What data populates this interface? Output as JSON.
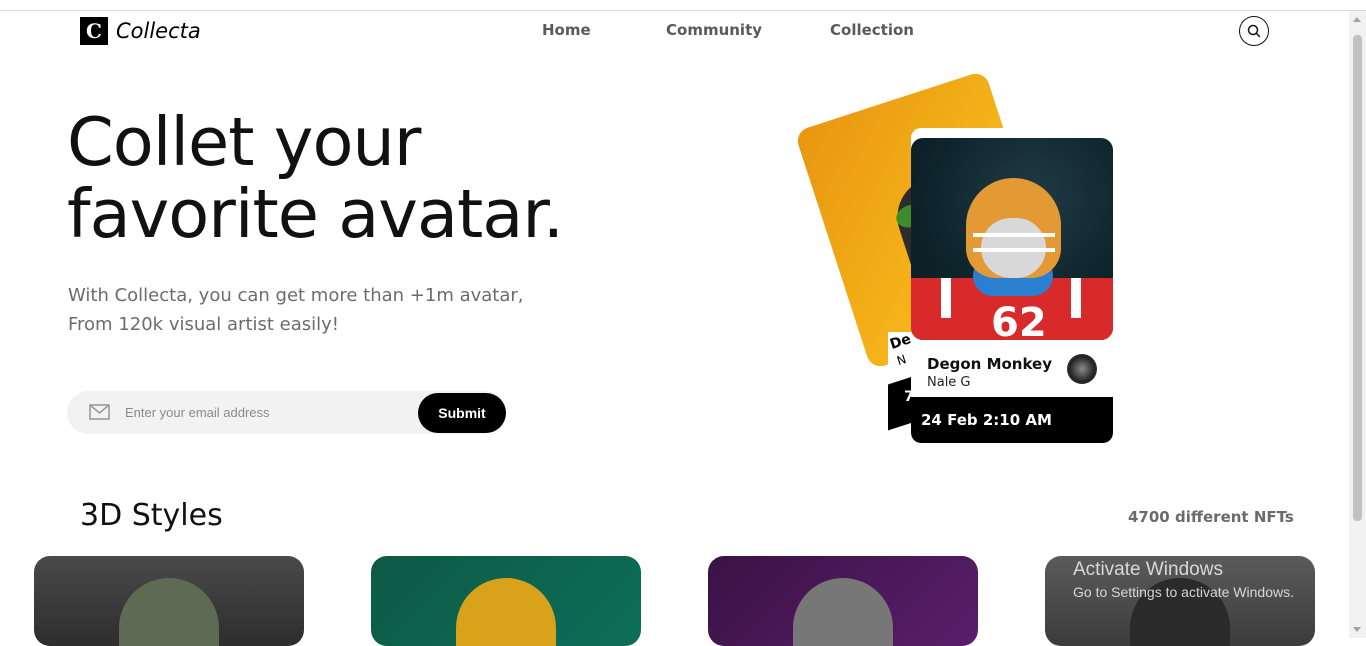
{
  "brand": {
    "mark": "C",
    "name": "Collecta"
  },
  "nav": {
    "items": [
      "Home",
      "Community",
      "Collection"
    ]
  },
  "hero": {
    "title_line1": "Collet your",
    "title_line2": "favorite avatar.",
    "subtitle_line1": "With Collecta, you can get more than +1m avatar,",
    "subtitle_line2": "From 120k visual artist easily!"
  },
  "email_form": {
    "placeholder": "Enter your email address",
    "submit_label": "Submit"
  },
  "featured_card": {
    "title": "Degon Monkey",
    "author": "Nale G",
    "date": "24 Feb 2:10 AM",
    "jersey_number": "62"
  },
  "back_card": {
    "label1": "De",
    "label2": "N",
    "partial": "7"
  },
  "section": {
    "title": "3D Styles",
    "count": "4700 different NFTs"
  },
  "watermark": {
    "line1": "Activate Windows",
    "line2": "Go to Settings to activate Windows."
  }
}
